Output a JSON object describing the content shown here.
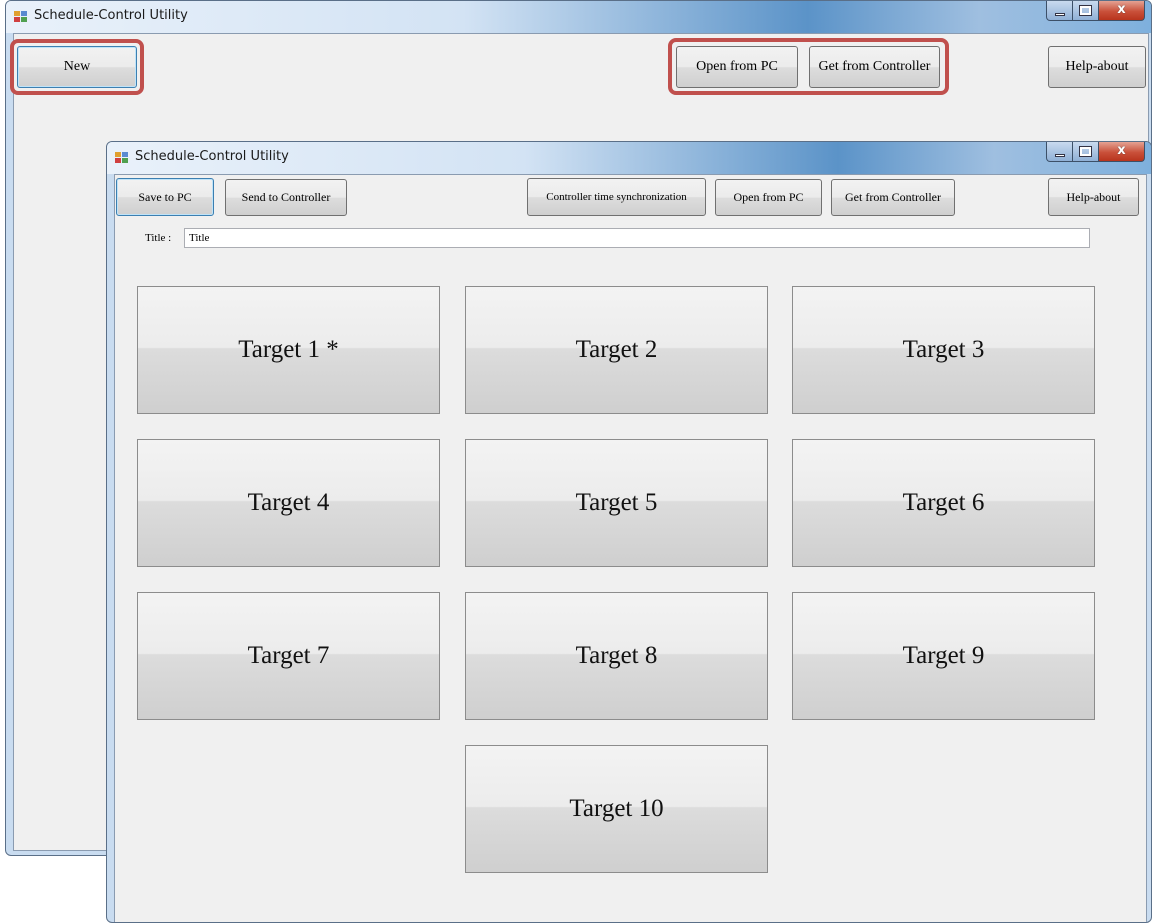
{
  "back_window": {
    "title": "Schedule-Control Utility",
    "buttons": {
      "new": "New",
      "open_from_pc": "Open from PC",
      "get_from_controller": "Get from Controller",
      "help_about": "Help-about"
    },
    "caption": {
      "close_glyph": "x"
    }
  },
  "front_window": {
    "title": "Schedule-Control Utility",
    "toolbar": {
      "save_to_pc": "Save to PC",
      "send_to_controller": "Send to Controller",
      "time_sync": "Controller time synchronization",
      "open_from_pc": "Open from PC",
      "get_from_controller": "Get from Controller",
      "help_about": "Help-about"
    },
    "title_field": {
      "label": "Title :",
      "value": "Title"
    },
    "targets": [
      "Target 1 *",
      "Target 2",
      "Target 3",
      "Target 4",
      "Target 5",
      "Target 6",
      "Target 7",
      "Target 8",
      "Target 9",
      "Target 10"
    ],
    "caption": {
      "close_glyph": "x"
    }
  },
  "highlight_color": "#c0504d",
  "icons": [
    "app-icon",
    "minimize-icon",
    "maximize-icon",
    "close-icon"
  ]
}
